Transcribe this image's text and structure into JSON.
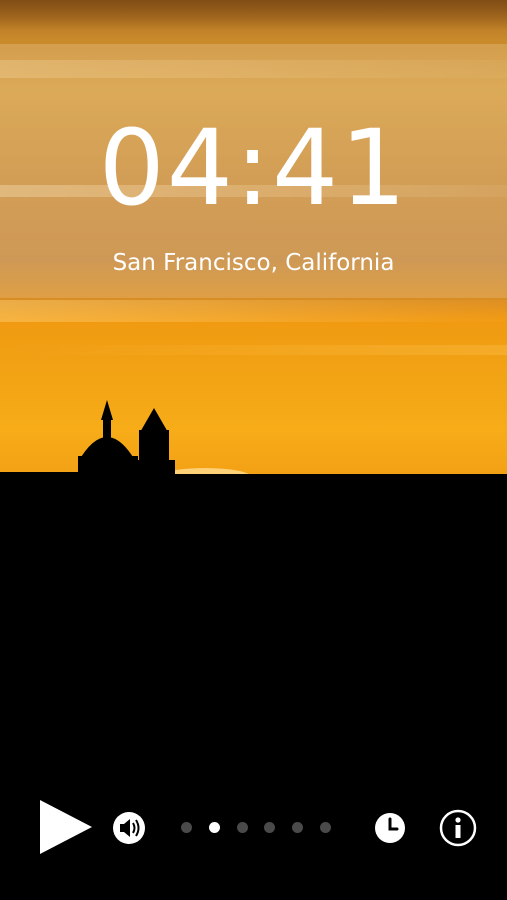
{
  "clock": {
    "time": "04:41",
    "location": "San Francisco, California"
  },
  "controls": {
    "play_icon": "play-icon",
    "sound_icon": "speaker-icon",
    "clock_icon": "clock-icon",
    "info_icon": "info-icon"
  },
  "pager": {
    "total_pages": 6,
    "active_page": 2
  },
  "colors": {
    "sky_top": "#a86a1c",
    "sky_sunset": "#f7ac18",
    "silhouette": "#000000",
    "text": "#ffffff",
    "dot_inactive": "#4a4a4a",
    "dot_active": "#ffffff"
  }
}
